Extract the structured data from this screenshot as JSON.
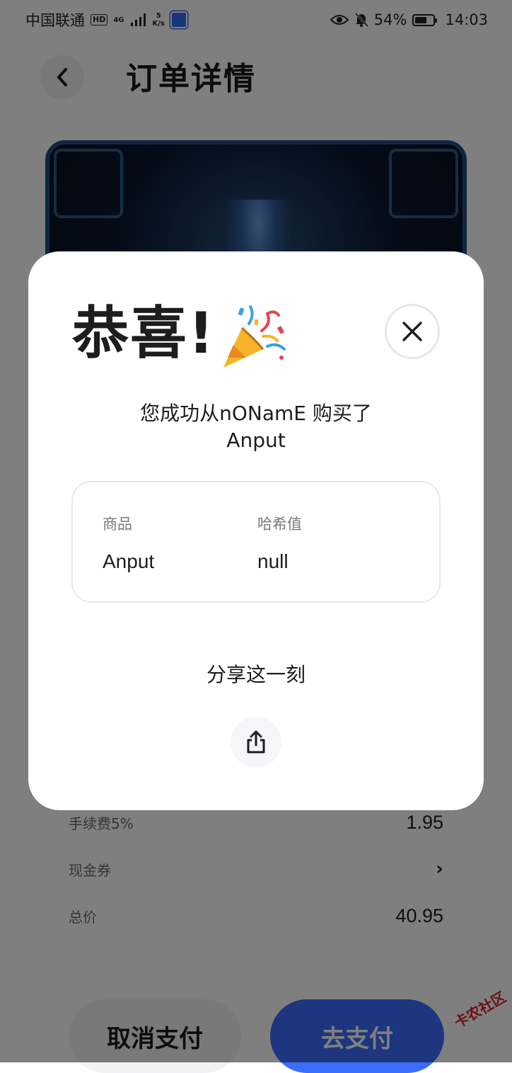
{
  "status_bar": {
    "carrier": "中国联通",
    "hd": "HD",
    "network": "4G",
    "speed_value": "5",
    "speed_unit": "K/s",
    "battery": "54%",
    "time": "14:03"
  },
  "header": {
    "title": "订单详情"
  },
  "fees": {
    "handling_fee_label": "手续费5%",
    "handling_fee_value": "1.95",
    "coupon_label": "现金券",
    "total_label": "总价",
    "total_value": "40.95"
  },
  "actions": {
    "cancel_label": "取消支付",
    "pay_label": "去支付"
  },
  "watermark": "卡农社区",
  "modal": {
    "title": "恭喜!",
    "message_line1": "您成功从nONamE 购买了",
    "message_line2": "Anput",
    "product_label": "商品",
    "product_value": "Anput",
    "hash_label": "哈希值",
    "hash_value": "null",
    "share_label": "分享这一刻"
  },
  "colors": {
    "accent": "#3b6dff",
    "overlay": "rgba(0,0,0,0.5)",
    "card_border": "#e8e8eb"
  },
  "icons": {
    "back": "chevron-left-icon",
    "close": "close-icon",
    "share": "share-icon",
    "celebration": "party-popper-icon",
    "coupon_arrow": "chevron-right-icon"
  }
}
